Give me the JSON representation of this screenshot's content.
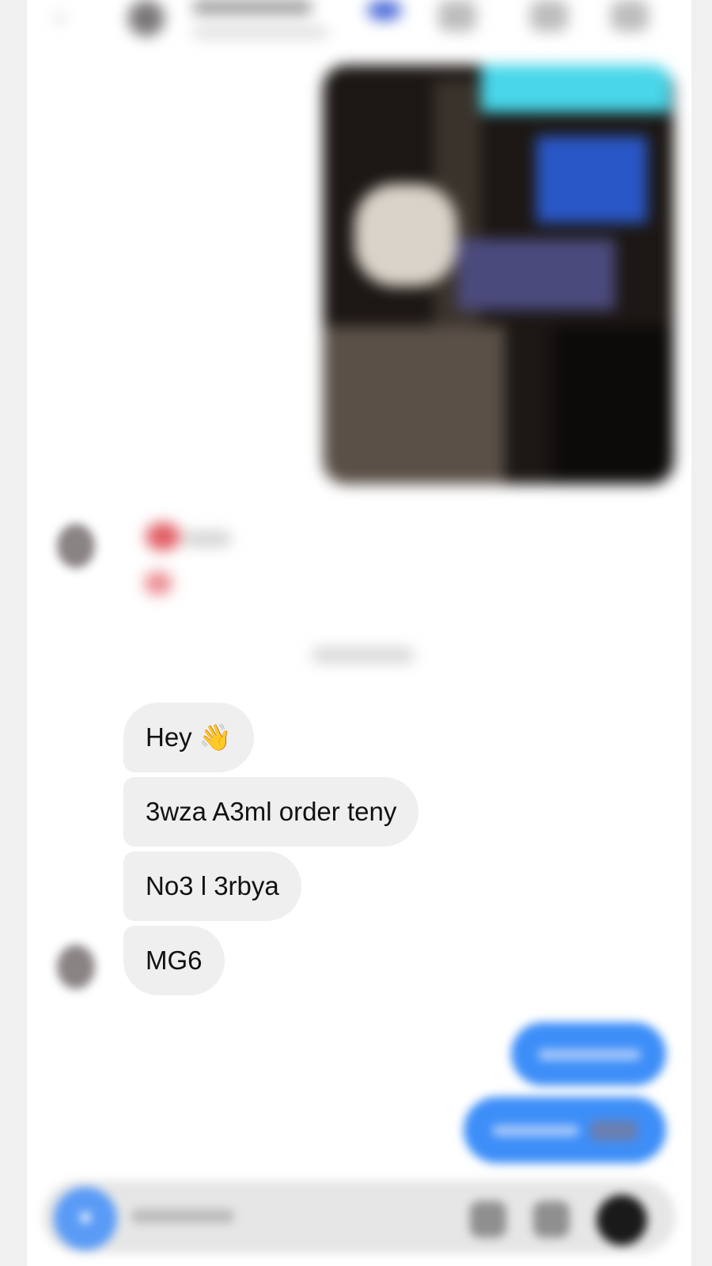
{
  "header": {
    "back_icon": "chevron-left-icon",
    "icons": [
      "phone-icon",
      "video-icon",
      "info-icon"
    ]
  },
  "conversation": {
    "shared_photo": {
      "description_icon": "photo-icon"
    },
    "incoming_messages": [
      {
        "text": "Hey",
        "emoji": "👋"
      },
      {
        "text": "3wza A3ml order teny"
      },
      {
        "text": "No3 l 3rbya"
      },
      {
        "text": "MG6"
      }
    ],
    "outgoing_messages_count_visible": 2
  },
  "composer": {
    "camera_icon": "camera-icon",
    "icons": [
      "microphone-icon",
      "image-icon",
      "sticker-icon"
    ]
  },
  "colors": {
    "incoming_bubble": "#efefef",
    "outgoing_bubble": "#3d8ef8",
    "background": "#ffffff",
    "page_margin": "#f0f0f0"
  }
}
